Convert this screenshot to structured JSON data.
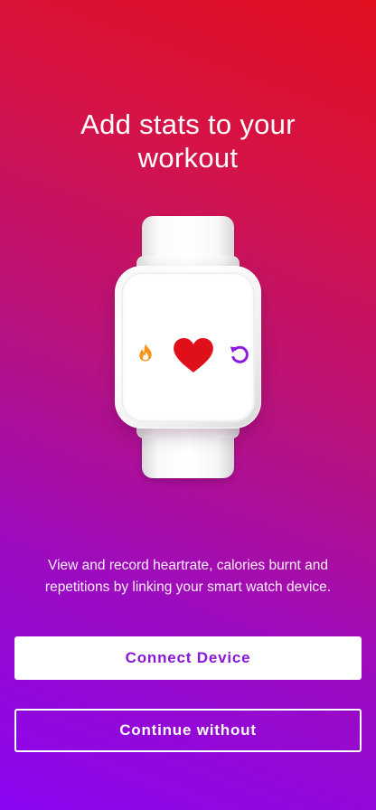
{
  "onboarding": {
    "title_line1": "Add stats to your",
    "title_line2": "workout",
    "description_line1": "View and record heartrate, calories burnt and",
    "description_line2": "repetitions by linking your smart watch device."
  },
  "watch_icons": {
    "left": "flame-icon",
    "center": "heart-icon",
    "right": "refresh-icon"
  },
  "actions": {
    "connect_label": "Connect Device",
    "continue_label": "Continue without"
  },
  "colors": {
    "gradient_top": "#e10f1f",
    "gradient_bottom": "#8a06f2",
    "accent_purple": "#8a16d9",
    "heart_red": "#e0101a",
    "flame_orange": "#f7941d",
    "refresh_purple": "#8c1be0"
  }
}
